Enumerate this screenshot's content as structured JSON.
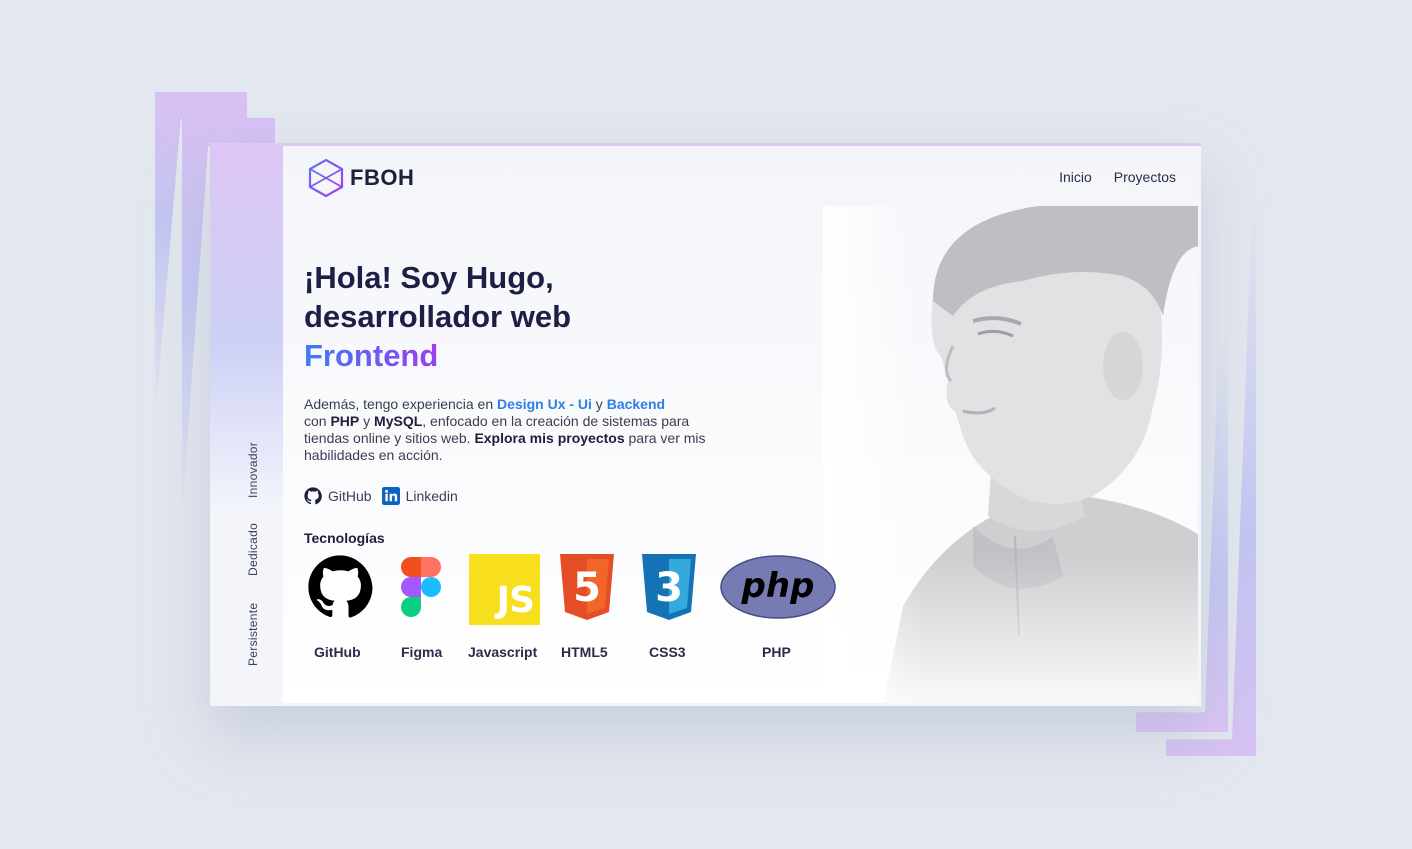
{
  "side_words": [
    "Innovador",
    "Dedicado",
    "Persistente"
  ],
  "header": {
    "logo_text": "FBOH",
    "nav": [
      "Inicio",
      "Proyectos"
    ]
  },
  "hero": {
    "line1": "¡Hola! Soy Hugo,",
    "line2": "desarrollador web",
    "accent": "Frontend"
  },
  "description": {
    "p1": "Además, tengo experiencia en ",
    "design": "Design Ux - Ui",
    "y1": " y ",
    "backend": "Backend",
    "con": " con ",
    "php": "PHP",
    "y2": " y ",
    "mysql": "MySQL",
    "p2": ", enfocado en la creación de sistemas para tiendas online y sitios web. ",
    "explora": "Explora mis proyectos",
    "p3": " para ver mis habilidades en acción."
  },
  "socials": [
    {
      "label": "GitHub",
      "icon": "github-icon"
    },
    {
      "label": "Linkedin",
      "icon": "linkedin-icon"
    }
  ],
  "tech_title": "Tecnologías",
  "technologies": [
    {
      "label": "GitHub",
      "icon": "github-icon"
    },
    {
      "label": "Figma",
      "icon": "figma-icon"
    },
    {
      "label": "Javascript",
      "icon": "javascript-icon",
      "logo_text": "JS"
    },
    {
      "label": "HTML5",
      "icon": "html5-icon",
      "logo_text": "5"
    },
    {
      "label": "CSS3",
      "icon": "css3-icon",
      "logo_text": "3"
    },
    {
      "label": "PHP",
      "icon": "php-icon",
      "logo_text": "php"
    }
  ],
  "colors": {
    "accent_blue": "#2f7ee8",
    "gradient_start": "#3e7cf1",
    "gradient_end": "#9a3ef0",
    "deco_violet": "#d9c0f3",
    "deco_periwinkle": "#c2c6f2"
  }
}
